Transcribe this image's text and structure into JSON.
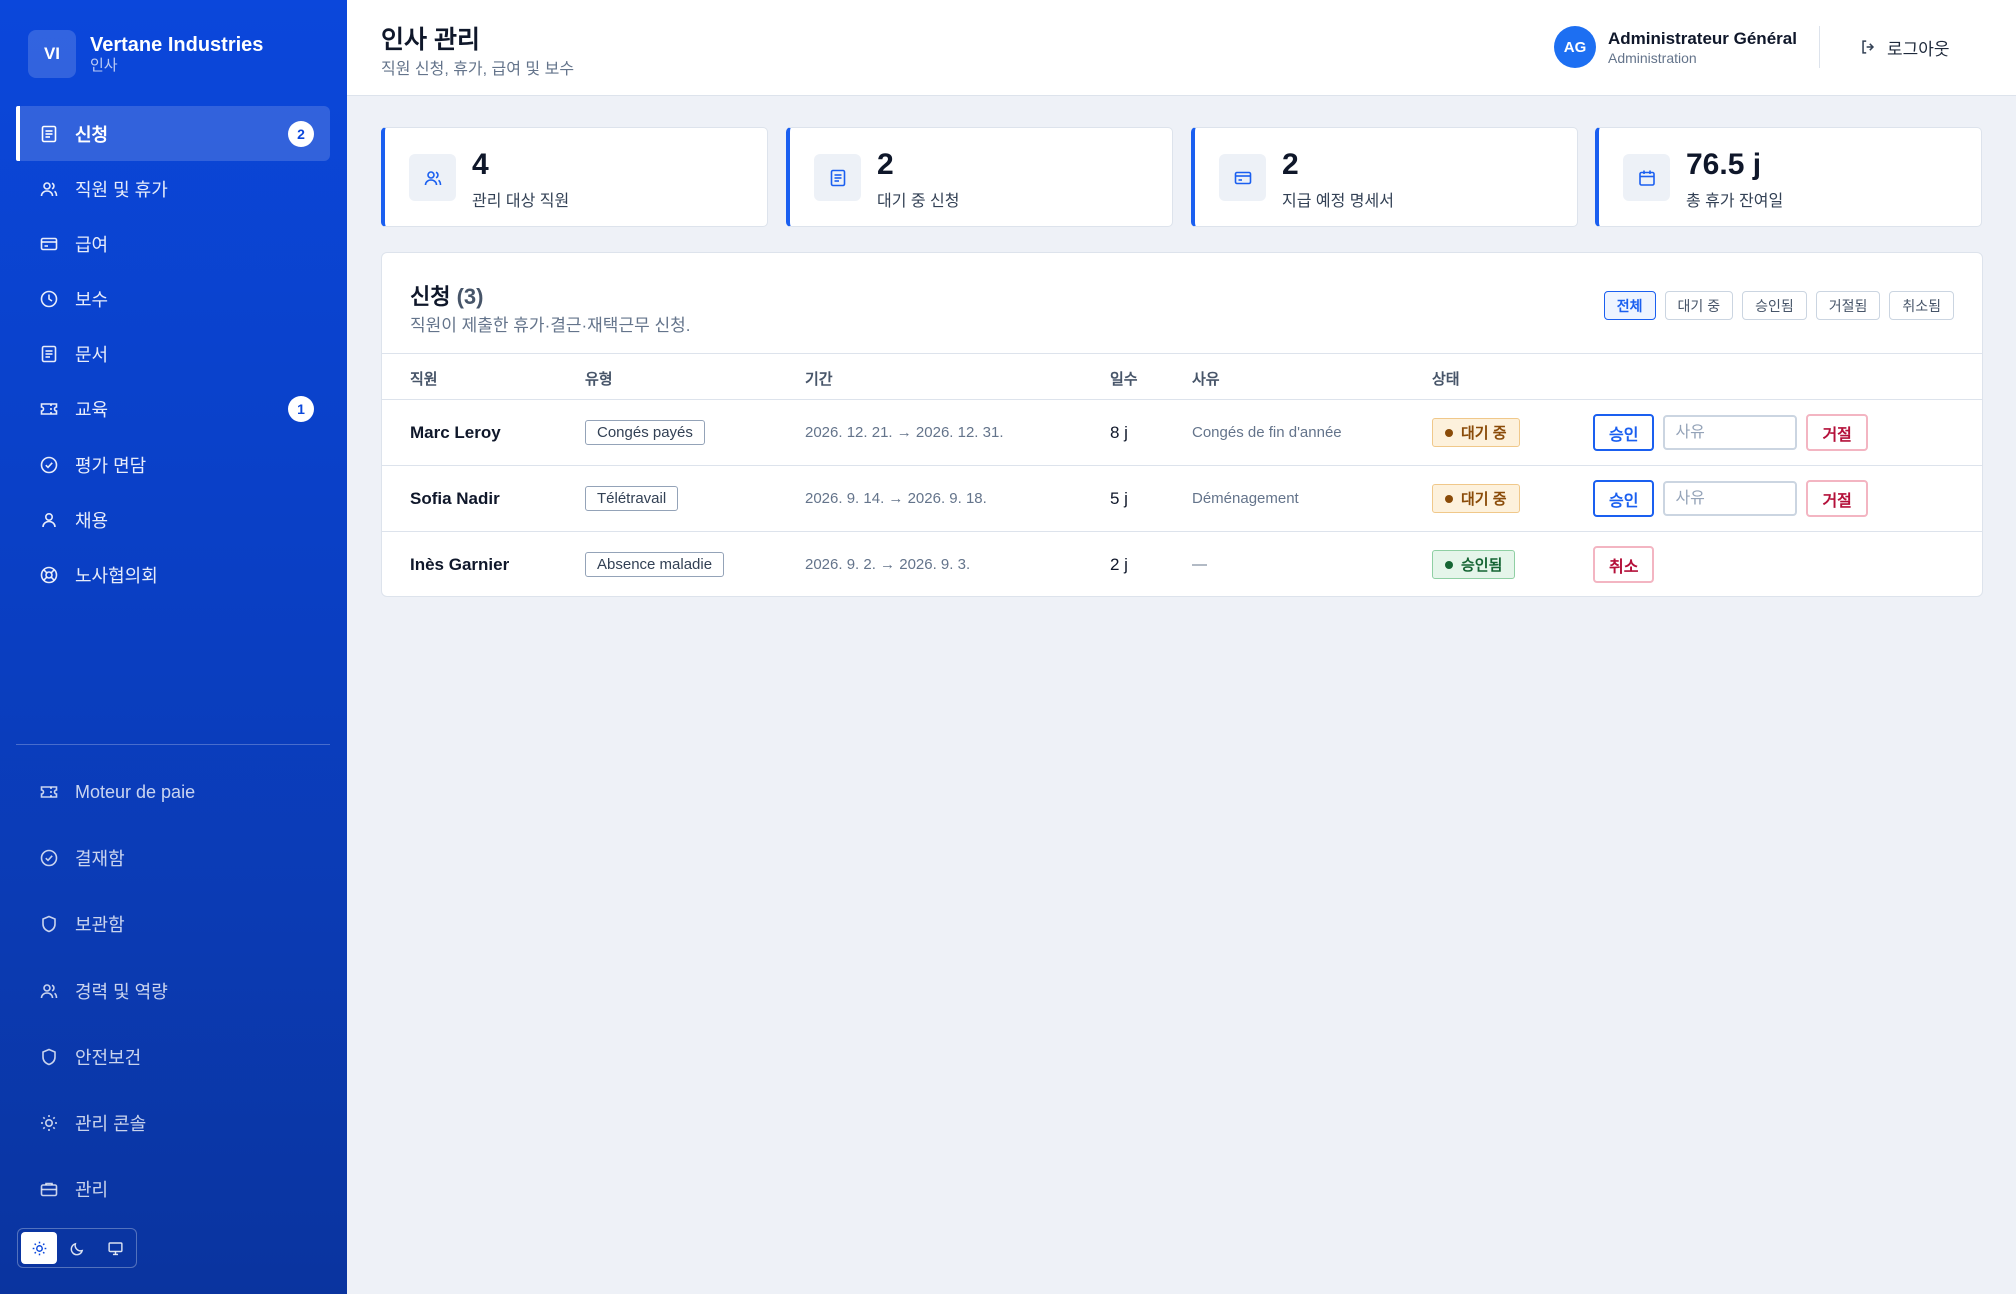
{
  "brand": {
    "initials": "VI",
    "name": "Vertane Industries",
    "sub": "인사"
  },
  "nav": {
    "primary": [
      {
        "label": "신청",
        "icon": "document-icon",
        "badge": "2",
        "active": true
      },
      {
        "label": "직원 및 휴가",
        "icon": "users-icon"
      },
      {
        "label": "급여",
        "icon": "card-icon"
      },
      {
        "label": "보수",
        "icon": "clock-icon"
      },
      {
        "label": "문서",
        "icon": "document-icon"
      },
      {
        "label": "교육",
        "icon": "ticket-icon",
        "badge": "1"
      },
      {
        "label": "평가 면담",
        "icon": "check-circle-icon"
      },
      {
        "label": "채용",
        "icon": "user-icon"
      },
      {
        "label": "노사협의회",
        "icon": "lifebuoy-icon"
      }
    ],
    "secondary": [
      {
        "label": "Moteur de paie",
        "icon": "ticket-icon"
      },
      {
        "label": "결재함",
        "icon": "check-circle-icon"
      },
      {
        "label": "보관함",
        "icon": "shield-icon"
      },
      {
        "label": "경력 및 역량",
        "icon": "users-icon"
      },
      {
        "label": "안전보건",
        "icon": "shield-icon"
      },
      {
        "label": "관리 콘솔",
        "icon": "sun-icon"
      },
      {
        "label": "관리",
        "icon": "briefcase-icon"
      }
    ]
  },
  "header": {
    "title": "인사 관리",
    "subtitle": "직원 신청, 휴가, 급여 및 보수",
    "user": {
      "initials": "AG",
      "name": "Administrateur Général",
      "role": "Administration"
    },
    "logout": "로그아웃"
  },
  "stats": [
    {
      "value": "4",
      "label": "관리 대상 직원",
      "icon": "users-icon"
    },
    {
      "value": "2",
      "label": "대기 중 신청",
      "icon": "document-icon"
    },
    {
      "value": "2",
      "label": "지급 예정 명세서",
      "icon": "card-icon"
    },
    {
      "value": "76.5 j",
      "label": "총 휴가 잔여일",
      "icon": "calendar-icon"
    }
  ],
  "requests": {
    "title": "신청",
    "count": "(3)",
    "subtitle": "직원이 제출한 휴가·결근·재택근무 신청.",
    "filters": [
      "전체",
      "대기 중",
      "승인됨",
      "거절됨",
      "취소됨"
    ],
    "columns": [
      "직원",
      "유형",
      "기간",
      "일수",
      "사유",
      "상태"
    ],
    "rows": [
      {
        "employee": "Marc Leroy",
        "type": "Congés payés",
        "period": "2026. 12. 21. → 2026. 12. 31.",
        "days": "8 j",
        "reason": "Congés de fin d'année",
        "status": "대기 중",
        "status_kind": "pending",
        "approve": "승인",
        "reason_placeholder": "사유",
        "reject": "거절"
      },
      {
        "employee": "Sofia Nadir",
        "type": "Télétravail",
        "period": "2026. 9. 14. → 2026. 9. 18.",
        "days": "5 j",
        "reason": "Déménagement",
        "status": "대기 중",
        "status_kind": "pending",
        "approve": "승인",
        "reason_placeholder": "사유",
        "reject": "거절"
      },
      {
        "employee": "Inès Garnier",
        "type": "Absence maladie",
        "period": "2026. 9. 2. → 2026. 9. 3.",
        "days": "2 j",
        "reason": "—",
        "status": "승인됨",
        "status_kind": "approved",
        "cancel": "취소"
      }
    ]
  }
}
